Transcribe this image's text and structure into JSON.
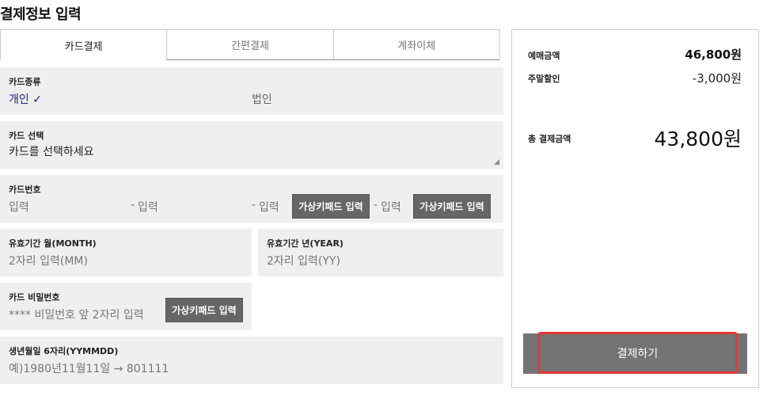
{
  "page_title": "결제정보 입력",
  "tabs": [
    {
      "label": "카드결제",
      "active": true
    },
    {
      "label": "간편결제",
      "active": false
    },
    {
      "label": "계좌이체",
      "active": false
    }
  ],
  "card_type": {
    "label": "카드종류",
    "personal": "개인",
    "personal_check": "✓",
    "corporate": "법인"
  },
  "card_select": {
    "label": "카드 선택",
    "placeholder": "카드를 선택하세요"
  },
  "card_number": {
    "label": "카드번호",
    "placeholder": "입력",
    "dash": "-",
    "vkb_label": "가상키패드 입력"
  },
  "expiry_month": {
    "label": "유효기간 월(MONTH)",
    "placeholder": "2자리 입력(MM)"
  },
  "expiry_year": {
    "label": "유효기간 년(YEAR)",
    "placeholder": "2자리 입력(YY)"
  },
  "card_password": {
    "label": "카드 비밀번호",
    "placeholder": "**** 비밀번호 앞 2자리 입력",
    "vkb_label": "가상키패드 입력"
  },
  "birth": {
    "label": "생년월일 6자리(YYMMDD)",
    "placeholder": "예)1980년11월11일 → 801111"
  },
  "summary": {
    "booking_label": "예매금액",
    "booking_value": "46,800원",
    "discount_label": "주말할인",
    "discount_value": "-3,000원",
    "total_label": "총 결제금액",
    "total_value": "43,800원",
    "pay_button": "결제하기"
  },
  "colors": {
    "accent_blue": "#1a237e",
    "highlight_red": "#e53935",
    "button_gray": "#737373"
  }
}
